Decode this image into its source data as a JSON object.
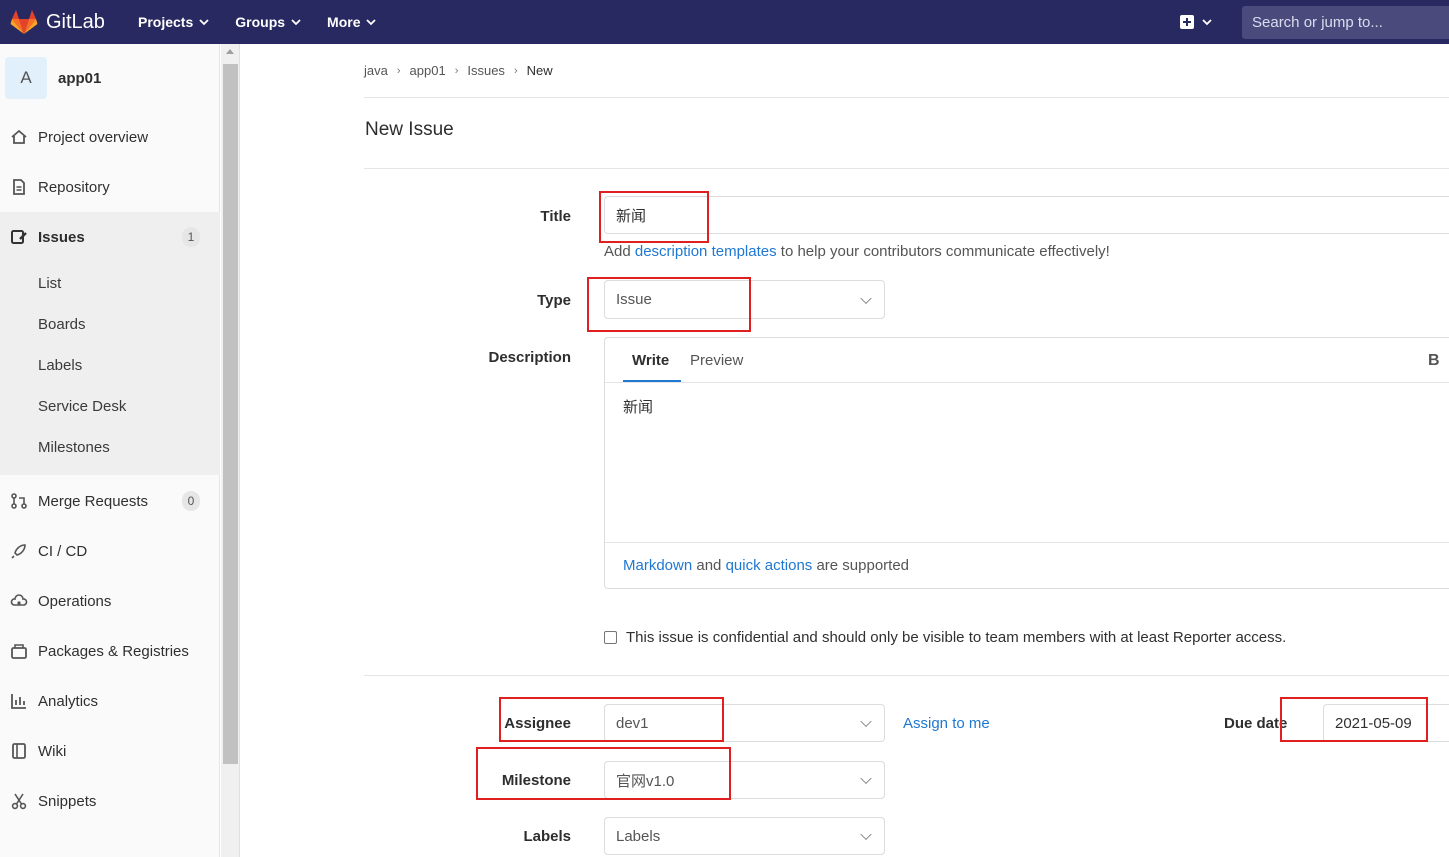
{
  "navbar": {
    "brand": "GitLab",
    "items": [
      "Projects",
      "Groups",
      "More"
    ],
    "search_placeholder": "Search or jump to..."
  },
  "sidebar": {
    "project_initial": "A",
    "project_name": "app01",
    "items": [
      {
        "label": "Project overview",
        "icon": "home-icon"
      },
      {
        "label": "Repository",
        "icon": "doc-icon"
      },
      {
        "label": "Issues",
        "icon": "issues-icon",
        "badge": "1"
      },
      {
        "label": "Merge Requests",
        "icon": "merge-icon",
        "badge": "0"
      },
      {
        "label": "CI / CD",
        "icon": "rocket-icon"
      },
      {
        "label": "Operations",
        "icon": "cloud-gear-icon"
      },
      {
        "label": "Packages & Registries",
        "icon": "package-icon"
      },
      {
        "label": "Analytics",
        "icon": "chart-icon"
      },
      {
        "label": "Wiki",
        "icon": "book-icon"
      },
      {
        "label": "Snippets",
        "icon": "scissors-icon"
      }
    ],
    "issue_sub": [
      "List",
      "Boards",
      "Labels",
      "Service Desk",
      "Milestones"
    ]
  },
  "breadcrumb": [
    "java",
    "app01",
    "Issues",
    "New"
  ],
  "page_title": "New Issue",
  "form": {
    "title_label": "Title",
    "title_value": "新闻",
    "help_prefix": "Add ",
    "help_link": "description templates",
    "help_suffix": " to help your contributors communicate effectively!",
    "type_label": "Type",
    "type_value": "Issue",
    "description_label": "Description",
    "tab_write": "Write",
    "tab_preview": "Preview",
    "bold_button": "B",
    "description_value": "新闻",
    "md_link1": "Markdown",
    "md_mid": " and ",
    "md_link2": "quick actions",
    "md_suffix": " are supported",
    "confidential_text": "This issue is confidential and should only be visible to team members with at least Reporter access.",
    "assignee_label": "Assignee",
    "assignee_value": "dev1",
    "assign_to_me": "Assign to me",
    "due_date_label": "Due date",
    "due_date_value": "2021-05-09",
    "milestone_label": "Milestone",
    "milestone_value": "官网v1.0",
    "labels_label": "Labels",
    "labels_value": "Labels"
  },
  "colors": {
    "navbar": "#292961",
    "link": "#1f78d1",
    "annotation_red": "#e02020"
  }
}
